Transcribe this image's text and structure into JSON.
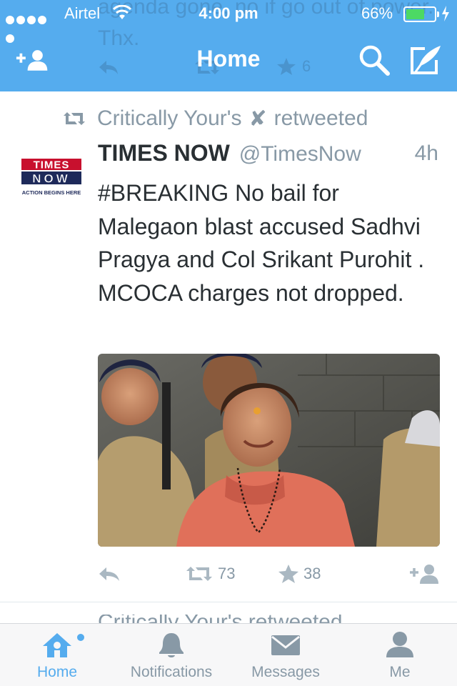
{
  "status_bar": {
    "carrier": "Airtel",
    "time": "4:00 pm",
    "battery_percent": "66%",
    "battery_level": 0.66
  },
  "background_tweet": {
    "text": "agenda gone, no if go out of power. Thx.",
    "favorites": "6"
  },
  "header": {
    "title": "Home"
  },
  "tweet": {
    "retweeted_by": "Critically Your's",
    "retweeted_by_mark": "✘",
    "retweet_label": "retweeted",
    "author": "TIMES NOW",
    "handle": "@TimesNow",
    "time": "4h",
    "text": "#BREAKING No bail for Malegaon blast accused Sadhvi Pragya and Col Srikant Purohit . MCOCA charges not dropped.",
    "avatar_lines": [
      "TIMES",
      "NOW",
      "ACTION BEGINS HERE"
    ],
    "retweets": "73",
    "favorites": "38"
  },
  "next_tweet_peek": "Critically Your's retweeted",
  "tabs": [
    {
      "label": "Home",
      "icon": "home-icon",
      "active": true
    },
    {
      "label": "Notifications",
      "icon": "bell-icon",
      "active": false
    },
    {
      "label": "Messages",
      "icon": "envelope-icon",
      "active": false
    },
    {
      "label": "Me",
      "icon": "person-icon",
      "active": false
    }
  ],
  "colors": {
    "brand_blue": "#55acee",
    "text_dark": "#292f33",
    "text_gray": "#8899a6",
    "battery_green": "#4cd964",
    "times_red": "#c8102e",
    "times_navy": "#1e2a5a"
  }
}
